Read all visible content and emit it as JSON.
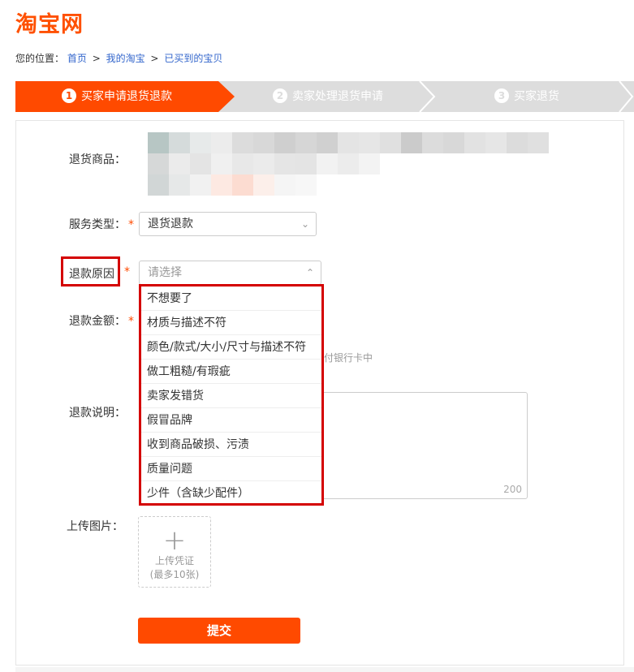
{
  "logo": "淘宝网",
  "breadcrumb": {
    "prefix": "您的位置：",
    "items": [
      "首页",
      "我的淘宝",
      "已买到的宝贝"
    ],
    "separator": ">"
  },
  "steps": [
    {
      "num": "1",
      "label": "买家申请退货退款",
      "active": true
    },
    {
      "num": "2",
      "label": "卖家处理退货申请",
      "active": false
    },
    {
      "num": "3",
      "label": "买家退货",
      "active": false
    }
  ],
  "form": {
    "product_label": "退货商品：",
    "service_label": "服务类型：",
    "service_value": "退货退款",
    "reason_label": "退款原因",
    "reason_placeholder": "请选择",
    "amount_label": "退款金额：",
    "amount_hint": "付银行卡中",
    "desc_label": "退款说明：",
    "desc_counter": "200",
    "upload_label": "上传图片：",
    "upload_text_1": "上传凭证",
    "upload_text_2": "(最多10张)",
    "submit_label": "提交",
    "required_mark": "*"
  },
  "reason_options": [
    "不想要了",
    "材质与描述不符",
    "颜色/款式/大小/尺寸与描述不符",
    "做工粗糙/有瑕疵",
    "卖家发错货",
    "假冒品牌",
    "收到商品破损、污渍",
    "质量问题",
    "少件（含缺少配件）"
  ],
  "colors": {
    "accent": "#ff4a00",
    "highlight_box": "#d40000",
    "link": "#3366cc"
  },
  "icons": {
    "select_chevron": "chevron-down-icon",
    "dropdown_chevron": "chevron-up-icon",
    "upload": "plus-icon"
  }
}
